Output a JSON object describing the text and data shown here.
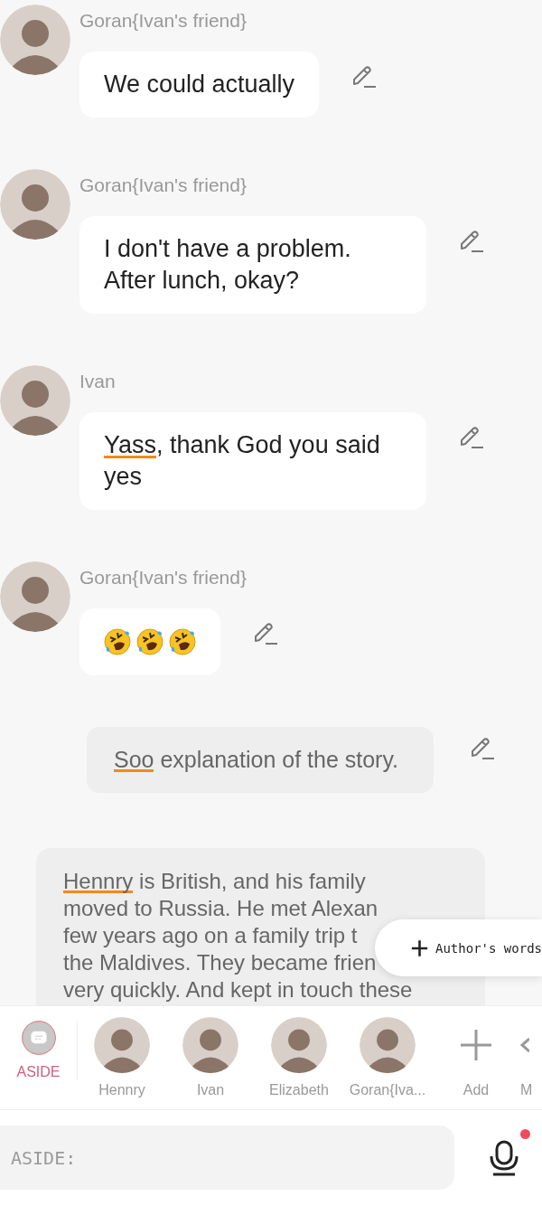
{
  "messages": [
    {
      "kind": "character",
      "name": "Goran{Ivan's friend}",
      "parts": [
        {
          "text": "We could actually",
          "misspelled": false
        }
      ]
    },
    {
      "kind": "character",
      "name": "Goran{Ivan's friend}",
      "parts": [
        {
          "text": "I don't have a problem. After lunch, okay?",
          "misspelled": false
        }
      ]
    },
    {
      "kind": "character",
      "name": "Ivan",
      "parts": [
        {
          "text": "Yass",
          "misspelled": true
        },
        {
          "text": ", thank God you said yes",
          "misspelled": false
        }
      ]
    },
    {
      "kind": "character",
      "name": "Goran{Ivan's friend}",
      "emojis": [
        {
          "kind": "rolling-laugh"
        },
        {
          "kind": "rolling-laugh"
        },
        {
          "kind": "rolling-laugh"
        }
      ]
    },
    {
      "kind": "aside",
      "parts": [
        {
          "text": "Soo",
          "misspelled": true
        },
        {
          "text": " explanation of the story.",
          "misspelled": false
        }
      ]
    },
    {
      "kind": "author",
      "lines": [
        [
          {
            "text": "Hennry",
            "misspelled": true
          },
          {
            "text": " is British, and his family",
            "misspelled": false
          }
        ],
        [
          {
            "text": "moved to Russia. He met Alexan",
            "misspelled": false
          }
        ],
        [
          {
            "text": "few years ago on a family trip t",
            "misspelled": false
          }
        ],
        [
          {
            "text": "the Maldives. They became frien",
            "misspelled": false
          }
        ],
        [
          {
            "text": "very quickly. And kept in touch these",
            "misspelled": false
          }
        ]
      ]
    }
  ],
  "author_words_button": {
    "label": "Author's words"
  },
  "characters": [
    {
      "kind": "aside",
      "label": "ASIDE",
      "selected": true
    },
    {
      "kind": "character",
      "label": "Hennry",
      "selected": false
    },
    {
      "kind": "character",
      "label": "Ivan",
      "selected": false
    },
    {
      "kind": "character",
      "label": "Elizabeth",
      "selected": false
    },
    {
      "kind": "character",
      "label": "Goran{Iva...",
      "selected": false
    },
    {
      "kind": "add",
      "label": "Add",
      "selected": false
    },
    {
      "kind": "more",
      "label": "M",
      "selected": false
    }
  ],
  "input": {
    "placeholder": "ASIDE:"
  },
  "mic": {
    "recording": true
  }
}
